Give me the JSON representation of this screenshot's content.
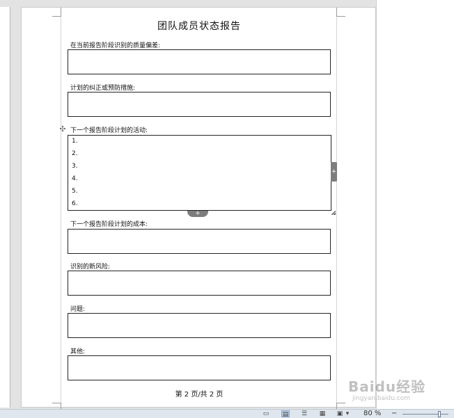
{
  "document": {
    "title": "团队成员状态报告",
    "sections": [
      {
        "label": "在当前报告阶段识别的质量偏差:"
      },
      {
        "label": "计划的纠正或预防措施:"
      },
      {
        "label": "下一个报告阶段计划的活动:",
        "items": [
          "1.",
          "2.",
          "3.",
          "4.",
          "5.",
          "6."
        ]
      },
      {
        "label": "下一个报告阶段计划的成本:"
      },
      {
        "label": "识别的新风险:"
      },
      {
        "label": "问题:"
      },
      {
        "label": "其他:"
      }
    ],
    "footer": "第 2 页/共 2 页"
  },
  "table_handles": {
    "move_icon": "move-cross-icon",
    "add_column_icon": "plus-icon",
    "add_row_icon": "plus-icon",
    "resize_icon": "resize-diagonal-icon"
  },
  "statusbar": {
    "view_icons": [
      "full-screen-reading-icon",
      "print-layout-icon",
      "web-layout-icon",
      "outline-icon",
      "draft-icon"
    ],
    "zoom_label": "80 %",
    "zoom_minus": "−",
    "zoom_fraction": 0.8
  },
  "watermark": {
    "main": "Baidu经验",
    "sub": "jingyan.baidu.com"
  },
  "colors": {
    "workspace": "#e3e3e3",
    "statusbar": "#dfe6ee",
    "handle": "#7d7d7d"
  }
}
